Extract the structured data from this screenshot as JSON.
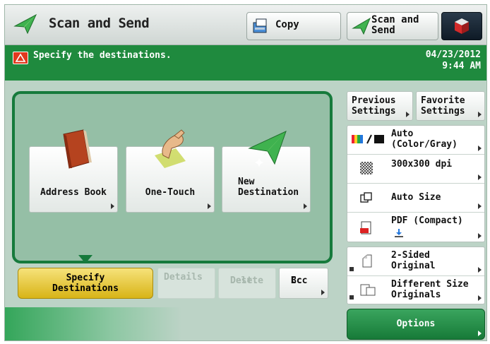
{
  "header": {
    "title": "Scan and Send",
    "copy_label": "Copy",
    "scan_send_label": [
      "Scan and",
      "Send"
    ]
  },
  "status_bar": {
    "message": "Specify the destinations.",
    "date": "04/23/2012",
    "time": "9:44 AM"
  },
  "destinations": [
    {
      "label": "Address Book",
      "icon": "address-book-icon"
    },
    {
      "label": "One-Touch",
      "icon": "one-touch-icon"
    },
    {
      "label": [
        "New",
        "Destination"
      ],
      "icon": "new-destination-icon"
    }
  ],
  "dest_actions": {
    "specify": [
      "Specify",
      "Destinations"
    ],
    "details": "Details",
    "delete": [
      "Delete",
      "Dest."
    ],
    "cc_bcc": [
      "Cc",
      "Bcc"
    ]
  },
  "settings": {
    "previous": [
      "Previous",
      "Settings"
    ],
    "favorite": [
      "Favorite",
      "Settings"
    ],
    "color": [
      "Auto",
      "(Color/Gray)"
    ],
    "resolution": "300x300 dpi",
    "size": "Auto Size",
    "file_format": "PDF (Compact)",
    "two_sided": [
      "2-Sided",
      "Original"
    ],
    "diff_size": [
      "Different Size",
      "Originals"
    ],
    "options": "Options"
  },
  "colors": {
    "accent_green": "#1f8a3e",
    "panel_green": "#95bfa6",
    "specify_yellow": "#e8c83a",
    "warning_red": "#e2391e"
  }
}
